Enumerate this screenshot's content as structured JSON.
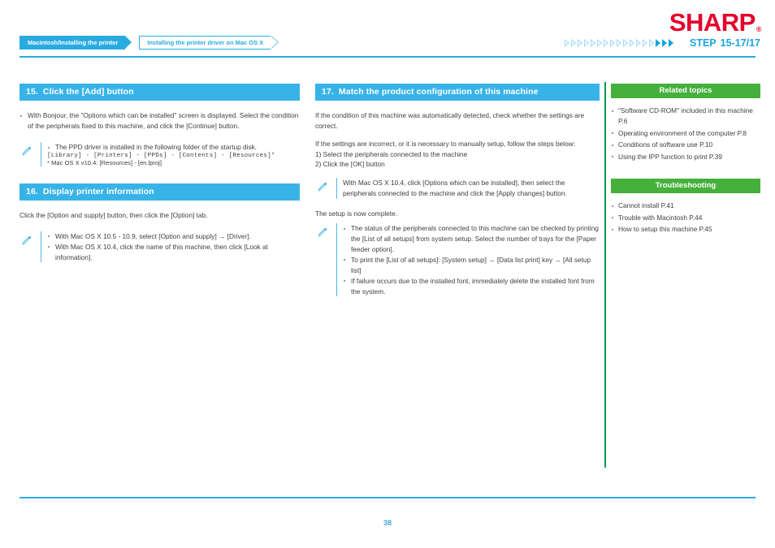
{
  "header": {
    "logo": "SHARP",
    "logo_reg": "®",
    "breadcrumbs": [
      {
        "label": "Macintosh/Installing the printer",
        "style": "filled"
      },
      {
        "label": "Installing the printer driver on Mac OS X",
        "style": "outline"
      }
    ],
    "progress": {
      "hollow_count": 14,
      "solid_count": 3,
      "step_word": "STEP",
      "step_value": "15-17/17"
    },
    "accent_color": "#29abe2",
    "brand_color": "#e4002b"
  },
  "columns": {
    "left": {
      "sections": [
        {
          "number": "15.",
          "title": "Click the [Add] button",
          "bullets": [
            "With Bonjour, the \"Options which can be installed\" screen is displayed. Select the condition of the peripherals fixed to this machine, and click the [Continue] button."
          ],
          "note": {
            "icon": "pencil-icon",
            "bullets": [
              "The PPD driver is installed in the following folder of the startup disk."
            ],
            "mono_line": "[Library] - [Printers] - [PPDs] - [Contents] - [Resources]*",
            "fine_line": "* Mac OS X v10.4: [Resources] - [en.lproj]"
          }
        },
        {
          "number": "16.",
          "title": "Display printer information",
          "paragraphs": [
            "Click the [Option and supply] button, then click the [Option] tab."
          ],
          "note": {
            "icon": "pencil-icon",
            "bullets": [
              "With Mac OS X 10.5 - 10.9, select [Option and supply] → [Driver].",
              "With Mac OS X 10.4, click the name of this machine, then click [Look at information]."
            ]
          }
        }
      ]
    },
    "middle": {
      "sections": [
        {
          "number": "17.",
          "title": "Match the product configuration of this machine",
          "paragraphs": [
            "If the condition of this machine was automatically detected, check whether the settings are correct.",
            "If the settings are incorrect, or it is necessary to manually setup, follow the steps below:",
            "1) Select the peripherals connected to the machine",
            "2) Click the [OK] button"
          ],
          "note_1": {
            "icon": "pencil-icon",
            "text": "With Mac OS X 10.4, click [Options which can be installed], then select the peripherals connected to the machine and click the [Apply changes] button."
          },
          "closing_paragraph": "The setup is now complete.",
          "note_2": {
            "icon": "pencil-icon",
            "bullets": [
              "The status of the peripherals connected to this machine can be checked by printing the [List of all setups] from system setup. Select the number of trays for the [Paper feeder option].",
              "To print the [List of all setups]: [System setup] → [Data list print] key → [All setup list]",
              "If failure occurs due to the installed font, immediately delete the installed font from the system."
            ]
          }
        }
      ]
    },
    "right": {
      "accent_color": "#45b03c",
      "blocks": [
        {
          "title": "Related topics",
          "items": [
            "\"Software CD-ROM\" included in this machine P.6",
            "Operating environment of the computer P.8",
            "Conditions of software use P.10",
            "Using the IPP function to print P.39"
          ]
        },
        {
          "title": "Troubleshooting",
          "items": [
            "Cannot install P.41",
            "Trouble with Macintosh P.44",
            "How to setup this machine P.45"
          ]
        }
      ]
    }
  },
  "footer": {
    "page_number": "38"
  }
}
